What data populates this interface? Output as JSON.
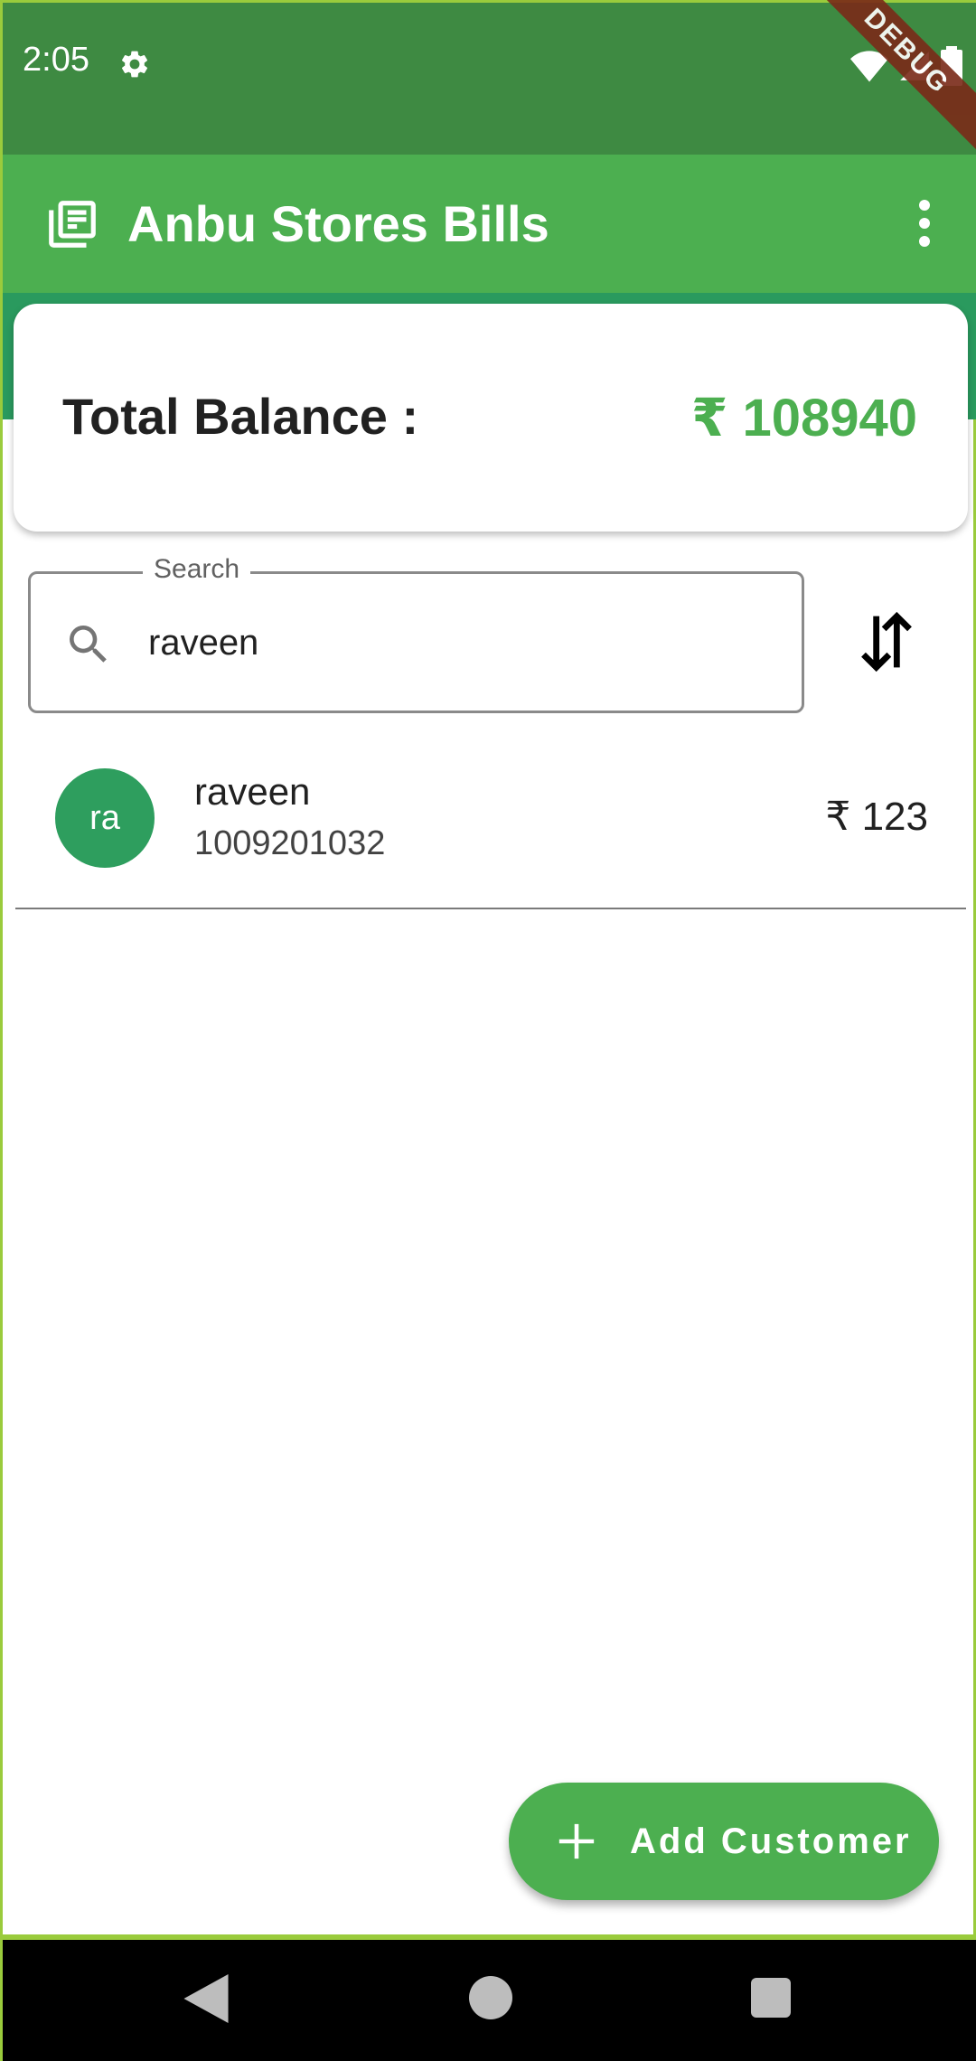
{
  "status_bar": {
    "time": "2:05",
    "icons": [
      "gear-icon",
      "wifi-icon",
      "signal-icon",
      "battery-icon"
    ],
    "debug_banner": "DEBUG"
  },
  "app_bar": {
    "title": "Anbu Stores Bills",
    "icon": "bills-icon",
    "menu_icon": "more-vert-icon",
    "color": "#4caf50"
  },
  "balance": {
    "label": "Total Balance :",
    "value": "₹ 108940",
    "value_color": "#4caf50"
  },
  "search": {
    "label": "Search",
    "value": "raveen",
    "icon": "search-icon"
  },
  "sort": {
    "icon": "swap-vertical-icon"
  },
  "customers": [
    {
      "initials": "ra",
      "name": "raveen",
      "phone": "1009201032",
      "amount": "₹ 123"
    }
  ],
  "fab": {
    "label": "Add Customer",
    "icon": "plus-icon"
  },
  "nav": {
    "icons": [
      "back-icon",
      "home-icon",
      "recents-icon"
    ]
  }
}
